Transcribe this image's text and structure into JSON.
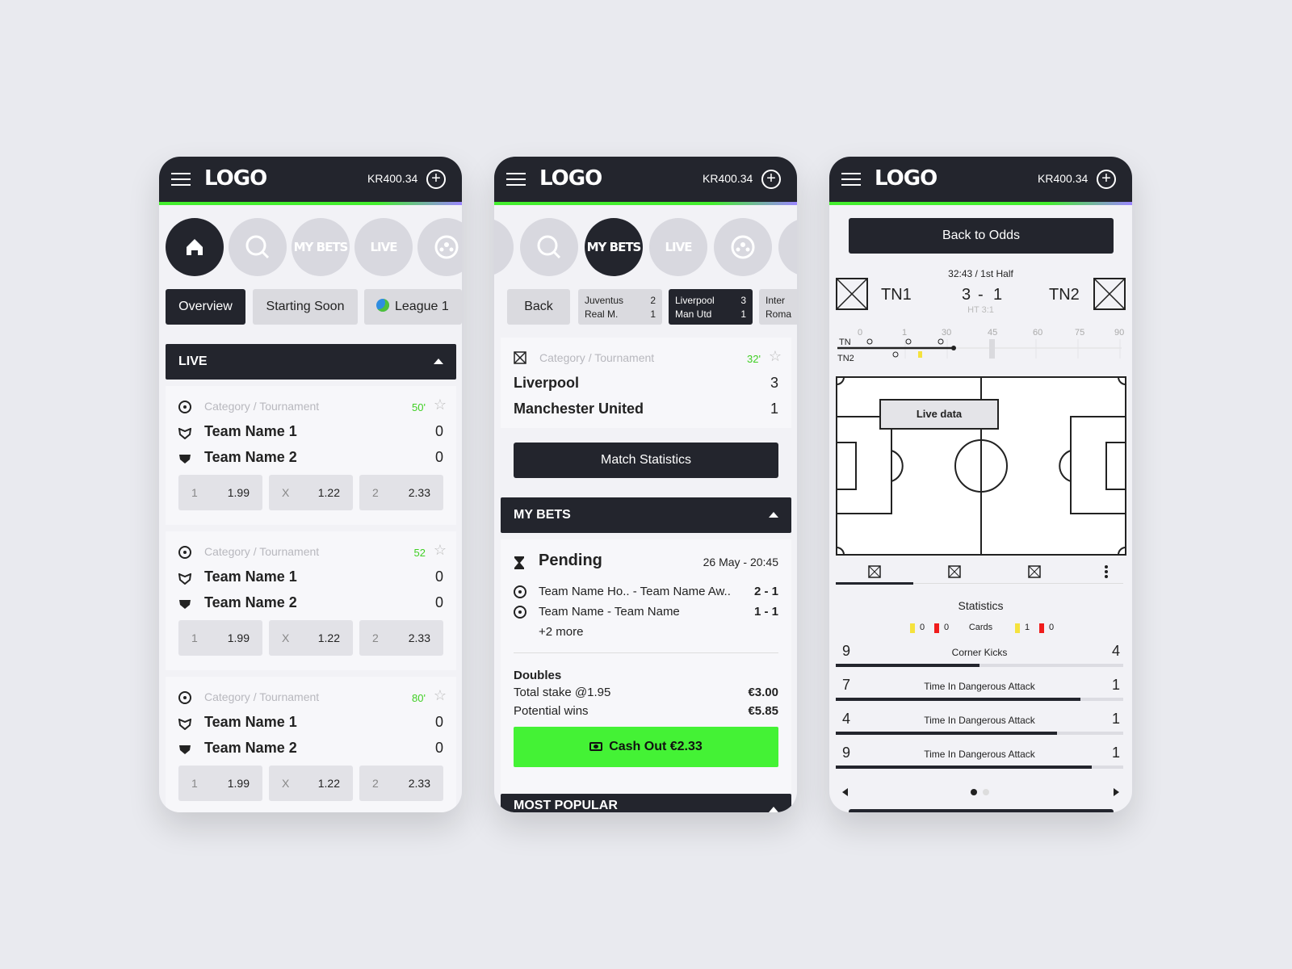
{
  "header": {
    "logo": "LOGO",
    "balance": "KR400.34"
  },
  "nav": {
    "mybets": "MY BETS",
    "live": "LIVE"
  },
  "screen1": {
    "tabs": [
      "Overview",
      "Starting Soon",
      "League 1"
    ],
    "live_label": "LIVE",
    "matches": [
      {
        "category": "Category / Tournament",
        "minute": "50'",
        "team1": "Team Name 1",
        "team2": "Team Name 2",
        "score1": "0",
        "score2": "0",
        "odds": [
          {
            "k": "1",
            "v": "1.99"
          },
          {
            "k": "X",
            "v": "1.22"
          },
          {
            "k": "2",
            "v": "2.33"
          }
        ]
      },
      {
        "category": "Category / Tournament",
        "minute": "52",
        "team1": "Team Name 1",
        "team2": "Team Name 2",
        "score1": "0",
        "score2": "0",
        "odds": [
          {
            "k": "1",
            "v": "1.99"
          },
          {
            "k": "X",
            "v": "1.22"
          },
          {
            "k": "2",
            "v": "2.33"
          }
        ]
      },
      {
        "category": "Category / Tournament",
        "minute": "80'",
        "team1": "Team Name 1",
        "team2": "Team Name 2",
        "score1": "0",
        "score2": "0",
        "odds": [
          {
            "k": "1",
            "v": "1.99"
          },
          {
            "k": "X",
            "v": "1.22"
          },
          {
            "k": "2",
            "v": "2.33"
          }
        ]
      }
    ]
  },
  "screen2": {
    "back": "Back",
    "chips": [
      {
        "t1": "Juventus",
        "s1": "2",
        "t2": "Real M.",
        "s2": "1"
      },
      {
        "t1": "Liverpool",
        "s1": "3",
        "t2": "Man Utd",
        "s2": "1"
      },
      {
        "t1": "Inter",
        "t2": "Roma"
      }
    ],
    "match": {
      "category": "Category / Tournament",
      "minute": "32'",
      "team1": "Liverpool",
      "score1": "3",
      "team2": "Manchester United",
      "score2": "1"
    },
    "stats_button": "Match Statistics",
    "mybets_label": "MY BETS",
    "bet": {
      "status": "Pending",
      "date": "26 May - 20:45",
      "lines": [
        {
          "teams": "Team Name Ho..  - Team Name Aw..",
          "score": "2 - 1"
        },
        {
          "teams": "Team Name  - Team Name",
          "score": "1 - 1"
        }
      ],
      "more": "+2 more",
      "type": "Doubles",
      "stake_label": "Total stake @1.95",
      "stake": "€3.00",
      "wins_label": "Potential wins",
      "wins": "€5.85",
      "cashout": "Cash Out €2.33"
    },
    "most_popular": "MOST POPULAR"
  },
  "screen3": {
    "back_to_odds": "Back to Odds",
    "time": "32:43 / 1st Half",
    "team1": "TN1",
    "team2": "TN2",
    "score1": "3",
    "score2": "1",
    "ht": "HT 3:1",
    "timeline": {
      "row1": "TN",
      "row2": "TN2",
      "ticks": [
        "0",
        "1",
        "30",
        "45",
        "60",
        "75",
        "90"
      ]
    },
    "live_data": "Live data",
    "stats_title": "Statistics",
    "cards": {
      "label": "Cards",
      "home_yellow": "0",
      "home_red": "0",
      "away_yellow": "1",
      "away_red": "0"
    },
    "rows": [
      {
        "label": "Corner Kicks",
        "home": "9",
        "away": "4",
        "share": 0.5
      },
      {
        "label": "Time In Dangerous Attack",
        "home": "7",
        "away": "1",
        "share": 0.85
      },
      {
        "label": "Time In Dangerous Attack",
        "home": "4",
        "away": "1",
        "share": 0.77
      },
      {
        "label": "Time In Dangerous Attack",
        "home": "9",
        "away": "1",
        "share": 0.89
      }
    ]
  }
}
